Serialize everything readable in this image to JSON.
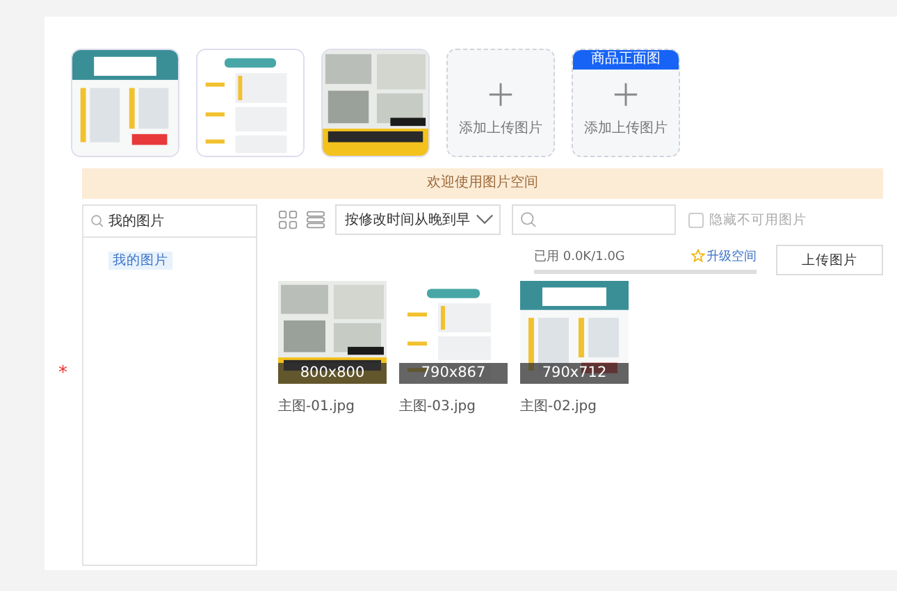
{
  "slots": [
    {
      "kind": "picture"
    },
    {
      "kind": "picture"
    },
    {
      "kind": "picture"
    },
    {
      "kind": "add",
      "label": "添加上传图片"
    },
    {
      "kind": "add",
      "badge": "商品正面图",
      "label": "添加上传图片"
    }
  ],
  "required_mark": "*",
  "banner": "欢迎使用图片空间",
  "folder_search": {
    "value": "我的图片"
  },
  "folders": [
    {
      "label": "我的图片",
      "selected": true
    }
  ],
  "sort": {
    "value": "按修改时间从晚到早"
  },
  "hide_unavailable": {
    "label": "隐藏不可用图片",
    "checked": false
  },
  "usage": {
    "text": "已用 0.0K/1.0G"
  },
  "upgrade": "升级空间",
  "upload_button": "上传图片",
  "images": [
    {
      "size": "800x800",
      "name": "主图-01.jpg"
    },
    {
      "size": "790x867",
      "name": "主图-03.jpg"
    },
    {
      "size": "790x712",
      "name": "主图-02.jpg"
    }
  ]
}
